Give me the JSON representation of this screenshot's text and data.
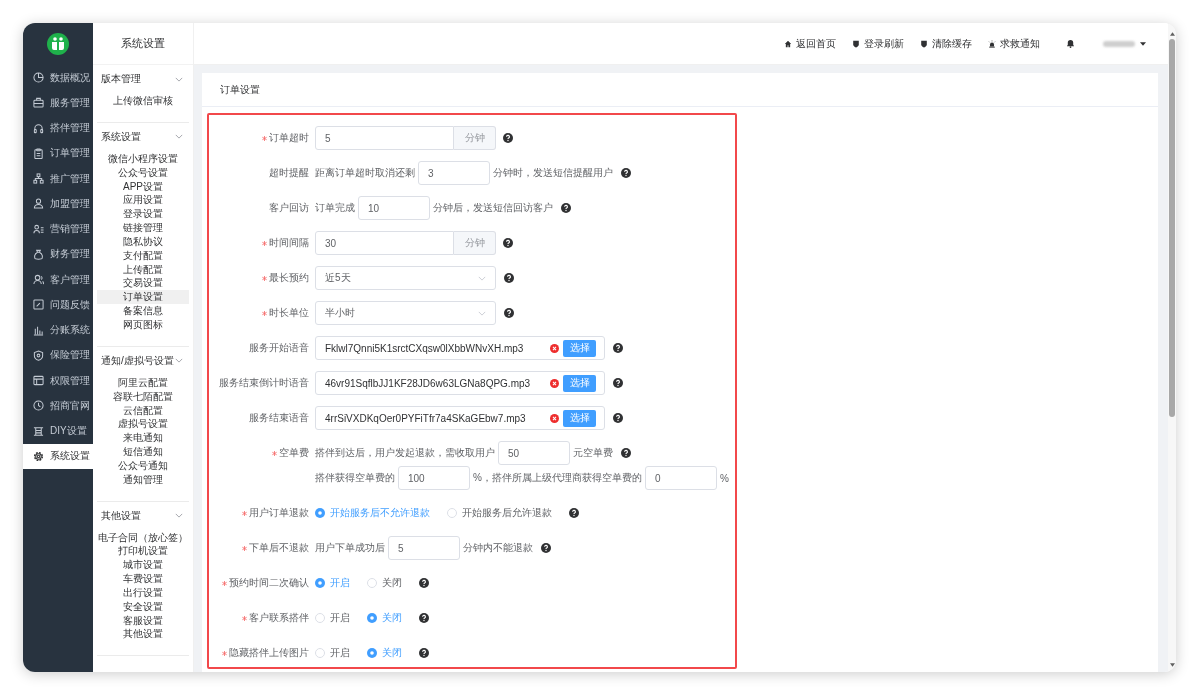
{
  "main_nav": {
    "items": [
      {
        "label": "数据概况",
        "selected": false
      },
      {
        "label": "服务管理",
        "selected": false
      },
      {
        "label": "搭伴管理",
        "selected": false
      },
      {
        "label": "订单管理",
        "selected": false
      },
      {
        "label": "推广管理",
        "selected": false
      },
      {
        "label": "加盟管理",
        "selected": false
      },
      {
        "label": "营销管理",
        "selected": false
      },
      {
        "label": "财务管理",
        "selected": false
      },
      {
        "label": "客户管理",
        "selected": false
      },
      {
        "label": "问题反馈",
        "selected": false
      },
      {
        "label": "分账系统",
        "selected": false
      },
      {
        "label": "保险管理",
        "selected": false
      },
      {
        "label": "权限管理",
        "selected": false
      },
      {
        "label": "招商官网",
        "selected": false
      },
      {
        "label": "DIY设置",
        "selected": false
      },
      {
        "label": "系统设置",
        "selected": true
      }
    ]
  },
  "sub_nav": {
    "title": "系统设置",
    "groups": [
      {
        "title": "版本管理",
        "expanded": true,
        "items": [
          {
            "label": "上传微信审核",
            "selected": false
          }
        ]
      },
      {
        "title": "系统设置",
        "expanded": true,
        "items": [
          {
            "label": "微信小程序设置",
            "selected": false
          },
          {
            "label": "公众号设置",
            "selected": false
          },
          {
            "label": "APP设置",
            "selected": false
          },
          {
            "label": "应用设置",
            "selected": false
          },
          {
            "label": "登录设置",
            "selected": false
          },
          {
            "label": "链接管理",
            "selected": false
          },
          {
            "label": "隐私协议",
            "selected": false
          },
          {
            "label": "支付配置",
            "selected": false
          },
          {
            "label": "上传配置",
            "selected": false
          },
          {
            "label": "交易设置",
            "selected": false
          },
          {
            "label": "订单设置",
            "selected": true
          },
          {
            "label": "备案信息",
            "selected": false
          },
          {
            "label": "网页图标",
            "selected": false
          }
        ]
      },
      {
        "title": "通知/虚拟号设置",
        "expanded": true,
        "items": [
          {
            "label": "阿里云配置",
            "selected": false
          },
          {
            "label": "容联七陌配置",
            "selected": false
          },
          {
            "label": "云信配置",
            "selected": false
          },
          {
            "label": "虚拟号设置",
            "selected": false
          },
          {
            "label": "来电通知",
            "selected": false
          },
          {
            "label": "短信通知",
            "selected": false
          },
          {
            "label": "公众号通知",
            "selected": false
          },
          {
            "label": "通知管理",
            "selected": false
          }
        ]
      },
      {
        "title": "其他设置",
        "expanded": true,
        "items": [
          {
            "label": "电子合同（放心签）",
            "selected": false
          },
          {
            "label": "打印机设置",
            "selected": false
          },
          {
            "label": "城市设置",
            "selected": false
          },
          {
            "label": "车费设置",
            "selected": false
          },
          {
            "label": "出行设置",
            "selected": false
          },
          {
            "label": "安全设置",
            "selected": false
          },
          {
            "label": "客服设置",
            "selected": false
          },
          {
            "label": "其他设置",
            "selected": false
          }
        ]
      }
    ]
  },
  "top_bar": {
    "links": [
      {
        "kind": "home",
        "label": "返回首页"
      },
      {
        "kind": "refresh",
        "label": "登录刷新"
      },
      {
        "kind": "cache",
        "label": "清除缓存"
      },
      {
        "kind": "alert",
        "label": "求救通知"
      }
    ]
  },
  "card": {
    "title": "订单设置"
  },
  "form": {
    "fields": [
      {
        "kind": "unit_input",
        "label": "订单超时",
        "required": true,
        "value": "5",
        "unit": "分钟"
      },
      {
        "kind": "inline",
        "label": "超时提醒",
        "required": false,
        "lines": [
          [
            {
              "kind": "text",
              "text": "距离订单超时取消还剩"
            },
            {
              "kind": "input",
              "value": "3"
            },
            {
              "kind": "text",
              "text": "分钟时，发送短信提醒用户"
            }
          ]
        ]
      },
      {
        "kind": "inline",
        "label": "客户回访",
        "required": false,
        "lines": [
          [
            {
              "kind": "text",
              "text": "订单完成"
            },
            {
              "kind": "input",
              "value": "10"
            },
            {
              "kind": "text",
              "text": "分钟后，发送短信回访客户"
            }
          ]
        ]
      },
      {
        "kind": "unit_input",
        "label": "时间间隔",
        "required": true,
        "value": "30",
        "unit": "分钟"
      },
      {
        "kind": "select",
        "label": "最长预约",
        "required": true,
        "value": "近5天"
      },
      {
        "kind": "select",
        "label": "时长单位",
        "required": true,
        "value": "半小时"
      },
      {
        "kind": "file",
        "label": "服务开始语音",
        "required": false,
        "value": "Fklwl7Qnni5K1srctCXqsw0lXbbWNvXH.mp3",
        "button": "选择"
      },
      {
        "kind": "file",
        "label": "服务结束倒计时语音",
        "required": false,
        "value": "46vr91SqflbJJ1KF28JD6w63LGNa8QPG.mp3",
        "button": "选择"
      },
      {
        "kind": "file",
        "label": "服务结束语音",
        "required": false,
        "value": "4rrSiVXDKqOer0PYFiTfr7a4SKaGEbw7.mp3",
        "button": "选择"
      },
      {
        "kind": "inline",
        "label": "空单费",
        "required": true,
        "lines": [
          [
            {
              "kind": "text",
              "text": "搭伴到达后，用户发起退款，需收取用户"
            },
            {
              "kind": "input",
              "value": "50"
            },
            {
              "kind": "text",
              "text": "元空单费"
            }
          ],
          [
            {
              "kind": "text",
              "text": "搭伴获得空单费的"
            },
            {
              "kind": "input",
              "value": "100"
            },
            {
              "kind": "text",
              "text": "%，搭伴所属上级代理商获得空单费的"
            },
            {
              "kind": "input",
              "value": "0"
            },
            {
              "kind": "text",
              "text": "%"
            }
          ]
        ]
      },
      {
        "kind": "radio",
        "label": "用户订单退款",
        "required": true,
        "options": [
          {
            "label": "开始服务后不允许退款",
            "selected": true
          },
          {
            "label": "开始服务后允许退款",
            "selected": false
          }
        ]
      },
      {
        "kind": "inline",
        "label": "下单后不退款",
        "required": true,
        "lines": [
          [
            {
              "kind": "text",
              "text": "用户下单成功后"
            },
            {
              "kind": "input",
              "value": "5"
            },
            {
              "kind": "text",
              "text": "分钟内不能退款"
            }
          ]
        ]
      },
      {
        "kind": "radio",
        "label": "预约时间二次确认",
        "required": true,
        "options": [
          {
            "label": "开启",
            "selected": true
          },
          {
            "label": "关闭",
            "selected": false
          }
        ]
      },
      {
        "kind": "radio",
        "label": "客户联系搭伴",
        "required": true,
        "options": [
          {
            "label": "开启",
            "selected": false
          },
          {
            "label": "关闭",
            "selected": true
          }
        ]
      },
      {
        "kind": "radio",
        "label": "隐藏搭伴上传图片",
        "required": true,
        "options": [
          {
            "label": "开启",
            "selected": false
          },
          {
            "label": "关闭",
            "selected": true
          }
        ]
      }
    ]
  }
}
